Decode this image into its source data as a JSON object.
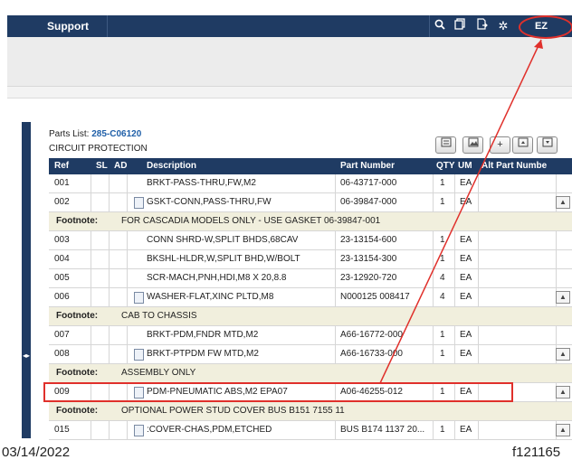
{
  "topbar": {
    "title": "Support",
    "tools": [
      "search-icon",
      "copy-icon",
      "export-icon",
      "gear-icon"
    ],
    "ez_label": "EZ ⚡",
    "color": "#1f3b63"
  },
  "parts_list": {
    "label": "Parts List:",
    "number": "285-C06120",
    "category": "CIRCUIT PROTECTION",
    "toolbar_icons": [
      "list-icon",
      "image-icon",
      "add-icon",
      "expand-all-icon",
      "collapse-all-icon"
    ],
    "toolbar_add_label": "+"
  },
  "table": {
    "headers": {
      "ref": "Ref",
      "sl": "SL",
      "ad": "AD",
      "description": "Description",
      "part_number": "Part Number",
      "qty": "QTY",
      "um": "UM",
      "alt": "Alt Part Numbe"
    },
    "rows": [
      {
        "type": "row",
        "ref": "001",
        "description": "BRKT-PASS-THRU,FW,M2",
        "part_number": "06-43717-000",
        "qty": "1",
        "um": "EA",
        "doc": false,
        "expand": false
      },
      {
        "type": "row",
        "ref": "002",
        "description": "GSKT-CONN,PASS-THRU,FW",
        "part_number": "06-39847-000",
        "qty": "1",
        "um": "EA",
        "doc": true,
        "expand": true
      },
      {
        "type": "foot",
        "label": "Footnote:",
        "text": "FOR CASCADIA MODELS ONLY - USE GASKET 06-39847-001"
      },
      {
        "type": "row",
        "ref": "003",
        "description": "CONN SHRD-W,SPLIT BHDS,68CAV",
        "part_number": "23-13154-600",
        "qty": "1",
        "um": "EA",
        "doc": false,
        "expand": false
      },
      {
        "type": "row",
        "ref": "004",
        "description": "BKSHL-HLDR,W,SPLIT BHD,W/BOLT",
        "part_number": "23-13154-300",
        "qty": "1",
        "um": "EA",
        "doc": false,
        "expand": false
      },
      {
        "type": "row",
        "ref": "005",
        "description": "SCR-MACH,PNH,HDI,M8 X 20,8.8",
        "part_number": "23-12920-720",
        "qty": "4",
        "um": "EA",
        "doc": false,
        "expand": false
      },
      {
        "type": "row",
        "ref": "006",
        "description": "WASHER-FLAT,XINC PLTD,M8",
        "part_number": "N000125 008417",
        "qty": "4",
        "um": "EA",
        "doc": true,
        "expand": true
      },
      {
        "type": "foot",
        "label": "Footnote:",
        "text": "CAB TO CHASSIS"
      },
      {
        "type": "row",
        "ref": "007",
        "description": "BRKT-PDM,FNDR MTD,M2",
        "part_number": "A66-16772-000",
        "qty": "1",
        "um": "EA",
        "doc": false,
        "expand": false
      },
      {
        "type": "row",
        "ref": "008",
        "description": "BRKT-PTPDM FW MTD,M2",
        "part_number": "A66-16733-000",
        "qty": "1",
        "um": "EA",
        "doc": true,
        "expand": true
      },
      {
        "type": "foot",
        "label": "Footnote:",
        "text": "ASSEMBLY ONLY"
      },
      {
        "type": "row",
        "ref": "009",
        "description": "PDM-PNEUMATIC ABS,M2 EPA07",
        "part_number": "A06-46255-012",
        "qty": "1",
        "um": "EA",
        "doc": true,
        "expand": true
      },
      {
        "type": "foot",
        "label": "Footnote:",
        "text": "OPTIONAL POWER STUD COVER BUS B151 7155 11"
      },
      {
        "type": "row",
        "ref": "015",
        "description": ":COVER-CHAS,PDM,ETCHED",
        "part_number": "BUS B174 1137 20...",
        "qty": "1",
        "um": "EA",
        "doc": true,
        "expand": true
      }
    ]
  },
  "caption": {
    "date": "03/14/2022",
    "figure": "f121165"
  },
  "accent_colors": {
    "callout": "#e0302b",
    "footnote_bg": "#f1efdd",
    "link": "#1f5fa8"
  }
}
